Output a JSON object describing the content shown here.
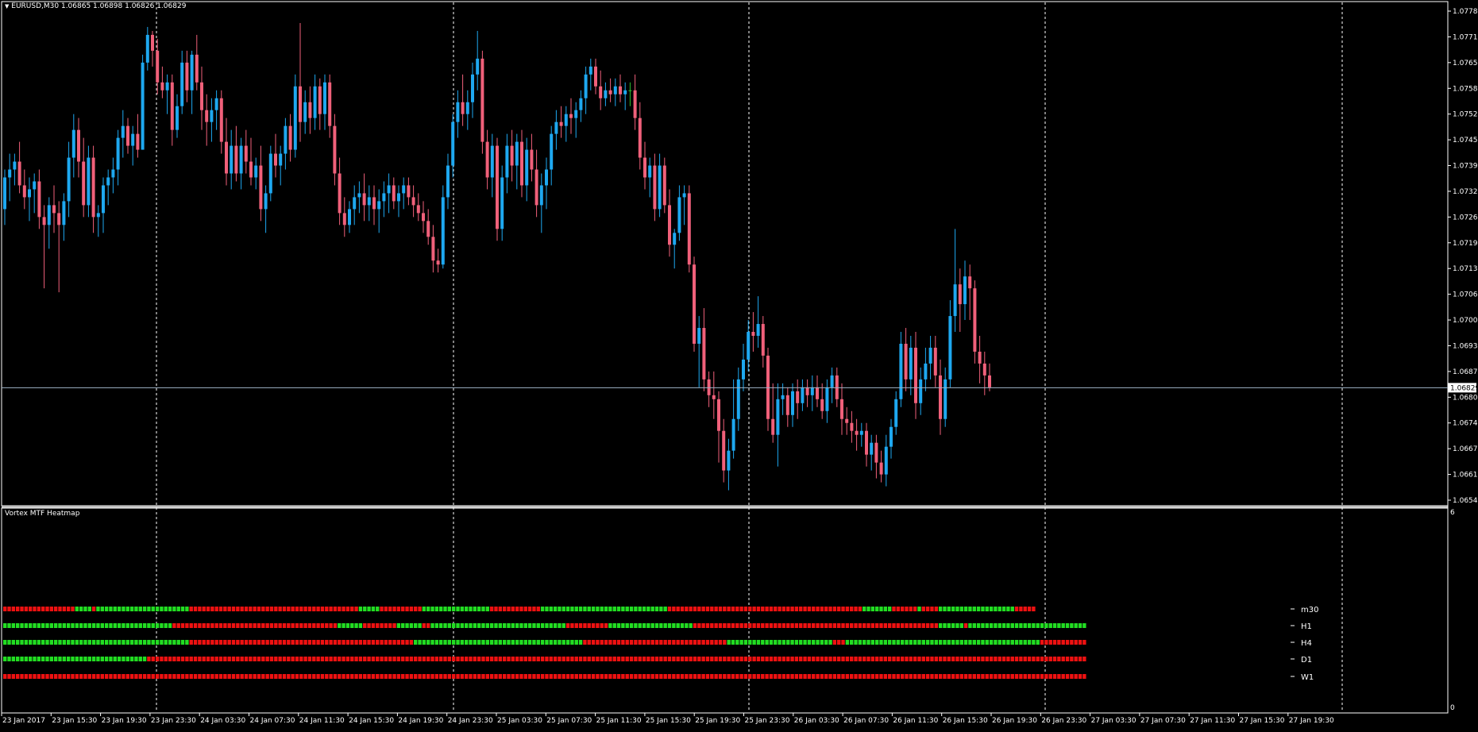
{
  "main_chart": {
    "symbol_line": "EURUSD,M30  1.06865 1.06898 1.06826 1.06829",
    "price_scale": {
      "labels": [
        "1.07780",
        "1.07715",
        "1.07650",
        "1.07585",
        "1.07520",
        "1.07455",
        "1.07390",
        "1.07325",
        "1.07260",
        "1.07195",
        "1.07130",
        "1.07065",
        "1.07000",
        "1.06935",
        "1.06870",
        "1.06805",
        "1.06740",
        "1.06675",
        "1.06610",
        "1.06545"
      ],
      "current_price": "1.06829"
    },
    "time_labels": [
      "23 Jan 2017",
      "23 Jan 15:30",
      "23 Jan 19:30",
      "23 Jan 23:30",
      "24 Jan 03:30",
      "24 Jan 07:30",
      "24 Jan 11:30",
      "24 Jan 15:30",
      "24 Jan 19:30",
      "24 Jan 23:30",
      "25 Jan 03:30",
      "25 Jan 07:30",
      "25 Jan 11:30",
      "25 Jan 15:30",
      "25 Jan 19:30",
      "25 Jan 23:30",
      "26 Jan 03:30",
      "26 Jan 07:30",
      "26 Jan 11:30",
      "26 Jan 15:30",
      "26 Jan 19:30",
      "26 Jan 23:30",
      "27 Jan 03:30",
      "27 Jan 07:30",
      "27 Jan 11:30",
      "27 Jan 15:30",
      "27 Jan 19:30"
    ],
    "colors": {
      "bull": "#1ea8f0",
      "bear": "#f0607a",
      "doji": "#2ec02e",
      "grid": "#ffffff",
      "price_line": "#9fb4c8"
    }
  },
  "indicator": {
    "title": "Vortex MTF Heatmap",
    "scale_top": "6",
    "scale_bottom": "0",
    "rows": [
      "m30",
      "H1",
      "H4",
      "D1",
      "W1"
    ],
    "colors": {
      "green": "#22dd22",
      "red": "#ee1111"
    }
  },
  "chart_data": {
    "type": "candlestick",
    "symbol": "EURUSD",
    "timeframe": "M30",
    "last_bar": {
      "open": 1.06865,
      "high": 1.06898,
      "low": 1.06826,
      "close": 1.06829
    },
    "ylim": [
      1.06545,
      1.0778
    ],
    "price_line": 1.06829,
    "grid": "vertical dashed separators",
    "ohlc": [
      [
        1.0728,
        1.0738,
        1.0724,
        1.0736
      ],
      [
        1.0736,
        1.0742,
        1.073,
        1.0738
      ],
      [
        1.0738,
        1.0742,
        1.0734,
        1.074
      ],
      [
        1.074,
        1.0745,
        1.0732,
        1.0734
      ],
      [
        1.0734,
        1.0738,
        1.0728,
        1.0731
      ],
      [
        1.0731,
        1.0736,
        1.0725,
        1.0733
      ],
      [
        1.0733,
        1.0737,
        1.0727,
        1.0735
      ],
      [
        1.0735,
        1.0738,
        1.0723,
        1.0726
      ],
      [
        1.0726,
        1.0729,
        1.0708,
        1.0724
      ],
      [
        1.0724,
        1.0731,
        1.0718,
        1.0729
      ],
      [
        1.0729,
        1.0734,
        1.0722,
        1.0727
      ],
      [
        1.0727,
        1.073,
        1.0707,
        1.0724
      ],
      [
        1.0724,
        1.0732,
        1.072,
        1.073
      ],
      [
        1.073,
        1.0745,
        1.0726,
        1.0741
      ],
      [
        1.0741,
        1.0752,
        1.0736,
        1.0748
      ],
      [
        1.0748,
        1.0751,
        1.0736,
        1.074
      ],
      [
        1.074,
        1.0746,
        1.0726,
        1.0729
      ],
      [
        1.0729,
        1.0744,
        1.0726,
        1.0741
      ],
      [
        1.0741,
        1.0744,
        1.0722,
        1.0726
      ],
      [
        1.0726,
        1.0729,
        1.0721,
        1.0727
      ],
      [
        1.0727,
        1.0736,
        1.0722,
        1.0734
      ],
      [
        1.0734,
        1.0738,
        1.0729,
        1.0736
      ],
      [
        1.0736,
        1.0741,
        1.0732,
        1.0738
      ],
      [
        1.0738,
        1.0748,
        1.0734,
        1.0746
      ],
      [
        1.0746,
        1.0753,
        1.0741,
        1.0749
      ],
      [
        1.0749,
        1.0751,
        1.0742,
        1.0744
      ],
      [
        1.0744,
        1.0749,
        1.0739,
        1.0747
      ],
      [
        1.0747,
        1.0752,
        1.0741,
        1.0743
      ],
      [
        1.0743,
        1.0767,
        1.0743,
        1.0765
      ],
      [
        1.0765,
        1.0774,
        1.0763,
        1.0772
      ],
      [
        1.0772,
        1.0773,
        1.0764,
        1.0768
      ],
      [
        1.0768,
        1.0771,
        1.0757,
        1.076
      ],
      [
        1.076,
        1.0764,
        1.0756,
        1.0758
      ],
      [
        1.0758,
        1.0762,
        1.0752,
        1.076
      ],
      [
        1.076,
        1.0762,
        1.0744,
        1.0748
      ],
      [
        1.0748,
        1.0757,
        1.0746,
        1.0754
      ],
      [
        1.0754,
        1.0768,
        1.0752,
        1.0765
      ],
      [
        1.0765,
        1.0768,
        1.0755,
        1.0758
      ],
      [
        1.0758,
        1.0768,
        1.0752,
        1.0767
      ],
      [
        1.0767,
        1.0772,
        1.0758,
        1.076
      ],
      [
        1.076,
        1.0764,
        1.0748,
        1.0753
      ],
      [
        1.0753,
        1.0757,
        1.0744,
        1.075
      ],
      [
        1.075,
        1.0756,
        1.0745,
        1.0753
      ],
      [
        1.0753,
        1.0758,
        1.0748,
        1.0756
      ],
      [
        1.0756,
        1.0758,
        1.0742,
        1.0745
      ],
      [
        1.0745,
        1.0751,
        1.0734,
        1.0737
      ],
      [
        1.0737,
        1.0748,
        1.0733,
        1.0744
      ],
      [
        1.0744,
        1.0749,
        1.0735,
        1.0737
      ],
      [
        1.0737,
        1.0746,
        1.0733,
        1.0744
      ],
      [
        1.0744,
        1.0748,
        1.0737,
        1.074
      ],
      [
        1.074,
        1.0746,
        1.0734,
        1.0736
      ],
      [
        1.0736,
        1.0741,
        1.0733,
        1.0739
      ],
      [
        1.0739,
        1.0744,
        1.0725,
        1.0728
      ],
      [
        1.0728,
        1.0734,
        1.0722,
        1.0732
      ],
      [
        1.0732,
        1.0744,
        1.073,
        1.0742
      ],
      [
        1.0742,
        1.0747,
        1.0736,
        1.0739
      ],
      [
        1.0739,
        1.0744,
        1.0734,
        1.0742
      ],
      [
        1.0742,
        1.0751,
        1.0738,
        1.0749
      ],
      [
        1.0749,
        1.0752,
        1.074,
        1.0743
      ],
      [
        1.0743,
        1.0762,
        1.0741,
        1.0759
      ],
      [
        1.0759,
        1.0775,
        1.0745,
        1.075
      ],
      [
        1.075,
        1.0758,
        1.0747,
        1.0755
      ],
      [
        1.0755,
        1.0759,
        1.0747,
        1.0751
      ],
      [
        1.0751,
        1.0762,
        1.0748,
        1.0759
      ],
      [
        1.0759,
        1.0761,
        1.0748,
        1.0752
      ],
      [
        1.0752,
        1.0762,
        1.0748,
        1.076
      ],
      [
        1.076,
        1.0762,
        1.0746,
        1.0749
      ],
      [
        1.0749,
        1.0752,
        1.0734,
        1.0737
      ],
      [
        1.0737,
        1.0741,
        1.0724,
        1.0727
      ],
      [
        1.0727,
        1.0731,
        1.0721,
        1.0724
      ],
      [
        1.0724,
        1.073,
        1.0722,
        1.0728
      ],
      [
        1.0728,
        1.0734,
        1.0724,
        1.0731
      ],
      [
        1.0731,
        1.0735,
        1.0727,
        1.0732
      ],
      [
        1.0732,
        1.0737,
        1.0725,
        1.0729
      ],
      [
        1.0729,
        1.0734,
        1.0725,
        1.0731
      ],
      [
        1.0731,
        1.0734,
        1.0724,
        1.0728
      ],
      [
        1.0728,
        1.0733,
        1.0722,
        1.073
      ],
      [
        1.073,
        1.0735,
        1.0726,
        1.0732
      ],
      [
        1.0732,
        1.0737,
        1.0727,
        1.0734
      ],
      [
        1.0734,
        1.0736,
        1.0728,
        1.073
      ],
      [
        1.073,
        1.0734,
        1.0726,
        1.0732
      ],
      [
        1.0732,
        1.0736,
        1.0728,
        1.0734
      ],
      [
        1.0734,
        1.0736,
        1.0729,
        1.0731
      ],
      [
        1.0731,
        1.0734,
        1.0726,
        1.0729
      ],
      [
        1.0729,
        1.0732,
        1.0725,
        1.0727
      ],
      [
        1.0727,
        1.073,
        1.0722,
        1.0725
      ],
      [
        1.0725,
        1.0728,
        1.0719,
        1.0721
      ],
      [
        1.0721,
        1.0724,
        1.0712,
        1.0715
      ],
      [
        1.0715,
        1.0718,
        1.0712,
        1.0714
      ],
      [
        1.0714,
        1.0734,
        1.0713,
        1.0731
      ],
      [
        1.0731,
        1.0742,
        1.0728,
        1.0739
      ],
      [
        1.0739,
        1.0752,
        1.0736,
        1.075
      ],
      [
        1.075,
        1.0758,
        1.0746,
        1.0755
      ],
      [
        1.0755,
        1.0762,
        1.0749,
        1.0752
      ],
      [
        1.0752,
        1.0758,
        1.0748,
        1.0755
      ],
      [
        1.0755,
        1.0765,
        1.0751,
        1.0762
      ],
      [
        1.0762,
        1.0773,
        1.0758,
        1.0766
      ],
      [
        1.0766,
        1.0768,
        1.0742,
        1.0745
      ],
      [
        1.0745,
        1.0748,
        1.0733,
        1.0736
      ],
      [
        1.0736,
        1.0747,
        1.0731,
        1.0744
      ],
      [
        1.0744,
        1.0746,
        1.072,
        1.0723
      ],
      [
        1.0723,
        1.0739,
        1.072,
        1.0736
      ],
      [
        1.0736,
        1.0747,
        1.0732,
        1.0744
      ],
      [
        1.0744,
        1.0748,
        1.0735,
        1.0739
      ],
      [
        1.0739,
        1.0747,
        1.0733,
        1.0745
      ],
      [
        1.0745,
        1.0748,
        1.0731,
        1.0734
      ],
      [
        1.0734,
        1.0746,
        1.073,
        1.0743
      ],
      [
        1.0743,
        1.0747,
        1.0735,
        1.0738
      ],
      [
        1.0738,
        1.0743,
        1.0726,
        1.0729
      ],
      [
        1.0729,
        1.0737,
        1.0722,
        1.0734
      ],
      [
        1.0734,
        1.0741,
        1.0728,
        1.0738
      ],
      [
        1.0738,
        1.0749,
        1.0734,
        1.0747
      ],
      [
        1.0747,
        1.0753,
        1.0743,
        1.075
      ],
      [
        1.075,
        1.0754,
        1.0746,
        1.0749
      ],
      [
        1.0749,
        1.0754,
        1.0745,
        1.0752
      ],
      [
        1.0752,
        1.0756,
        1.0747,
        1.0751
      ],
      [
        1.0751,
        1.0755,
        1.0746,
        1.0753
      ],
      [
        1.0753,
        1.0758,
        1.075,
        1.0756
      ],
      [
        1.0756,
        1.0764,
        1.0752,
        1.0762
      ],
      [
        1.0762,
        1.0766,
        1.0758,
        1.0764
      ],
      [
        1.0764,
        1.0766,
        1.0757,
        1.0759
      ],
      [
        1.0759,
        1.0763,
        1.0753,
        1.0756
      ],
      [
        1.0756,
        1.076,
        1.0754,
        1.0758
      ],
      [
        1.0758,
        1.0761,
        1.0755,
        1.0757
      ],
      [
        1.0757,
        1.0761,
        1.0754,
        1.0759
      ],
      [
        1.0759,
        1.0762,
        1.0755,
        1.0757
      ],
      [
        1.0757,
        1.076,
        1.0753,
        1.0758
      ],
      [
        1.0758,
        1.076,
        1.0754,
        1.0758
      ],
      [
        1.0758,
        1.0762,
        1.0748,
        1.0751
      ],
      [
        1.0751,
        1.0755,
        1.0738,
        1.0741
      ],
      [
        1.0741,
        1.0745,
        1.0733,
        1.0736
      ],
      [
        1.0736,
        1.0741,
        1.0731,
        1.0739
      ],
      [
        1.0739,
        1.0742,
        1.0725,
        1.0728
      ],
      [
        1.0728,
        1.0742,
        1.0726,
        1.0739
      ],
      [
        1.0739,
        1.0741,
        1.0727,
        1.0729
      ],
      [
        1.0729,
        1.0733,
        1.0716,
        1.0719
      ],
      [
        1.0719,
        1.0723,
        1.0713,
        1.0722
      ],
      [
        1.0722,
        1.0734,
        1.072,
        1.0731
      ],
      [
        1.0731,
        1.0734,
        1.0724,
        1.0732
      ],
      [
        1.0732,
        1.0734,
        1.0712,
        1.0714
      ],
      [
        1.0714,
        1.0716,
        1.0692,
        1.0694
      ],
      [
        1.0694,
        1.0701,
        1.0683,
        1.0698
      ],
      [
        1.0698,
        1.0703,
        1.0682,
        1.0685
      ],
      [
        1.0685,
        1.0687,
        1.0678,
        1.0681
      ],
      [
        1.0681,
        1.0687,
        1.0675,
        1.068
      ],
      [
        1.068,
        1.0682,
        1.0664,
        1.0672
      ],
      [
        1.0672,
        1.0675,
        1.0659,
        1.0662
      ],
      [
        1.0662,
        1.067,
        1.0657,
        1.0667
      ],
      [
        1.0667,
        1.0685,
        1.0665,
        1.0675
      ],
      [
        1.0675,
        1.0688,
        1.0672,
        1.0685
      ],
      [
        1.0685,
        1.0694,
        1.0682,
        1.069
      ],
      [
        1.069,
        1.07,
        1.0687,
        1.0697
      ],
      [
        1.0697,
        1.0702,
        1.0692,
        1.0696
      ],
      [
        1.0696,
        1.0706,
        1.0693,
        1.0699
      ],
      [
        1.0699,
        1.0701,
        1.0688,
        1.0691
      ],
      [
        1.0691,
        1.0693,
        1.0672,
        1.0675
      ],
      [
        1.0675,
        1.0684,
        1.0669,
        1.0671
      ],
      [
        1.0671,
        1.0684,
        1.0663,
        1.068
      ],
      [
        1.068,
        1.0684,
        1.0676,
        1.0681
      ],
      [
        1.0681,
        1.0683,
        1.0673,
        1.0676
      ],
      [
        1.0676,
        1.0684,
        1.0673,
        1.0682
      ],
      [
        1.0682,
        1.0685,
        1.0675,
        1.0679
      ],
      [
        1.0679,
        1.0685,
        1.0677,
        1.0683
      ],
      [
        1.0683,
        1.0685,
        1.0678,
        1.0681
      ],
      [
        1.0681,
        1.0686,
        1.0677,
        1.0683
      ],
      [
        1.0683,
        1.0686,
        1.0678,
        1.068
      ],
      [
        1.068,
        1.0684,
        1.0675,
        1.0677
      ],
      [
        1.0677,
        1.0685,
        1.0674,
        1.0683
      ],
      [
        1.0683,
        1.0688,
        1.0679,
        1.0686
      ],
      [
        1.0686,
        1.0688,
        1.0678,
        1.068
      ],
      [
        1.068,
        1.0684,
        1.0671,
        1.0675
      ],
      [
        1.0675,
        1.0678,
        1.0671,
        1.0674
      ],
      [
        1.0674,
        1.0677,
        1.0669,
        1.0672
      ],
      [
        1.0672,
        1.0675,
        1.0667,
        1.0671
      ],
      [
        1.0671,
        1.0674,
        1.0668,
        1.0672
      ],
      [
        1.0672,
        1.0674,
        1.0663,
        1.0666
      ],
      [
        1.0666,
        1.0671,
        1.0662,
        1.0669
      ],
      [
        1.0669,
        1.0671,
        1.066,
        1.0664
      ],
      [
        1.0664,
        1.0667,
        1.0659,
        1.0661
      ],
      [
        1.0661,
        1.0671,
        1.0658,
        1.0668
      ],
      [
        1.0668,
        1.0675,
        1.0665,
        1.0673
      ],
      [
        1.0673,
        1.0682,
        1.0671,
        1.068
      ],
      [
        1.068,
        1.0697,
        1.0678,
        1.0694
      ],
      [
        1.0694,
        1.0698,
        1.0682,
        1.0685
      ],
      [
        1.0685,
        1.0696,
        1.0681,
        1.0693
      ],
      [
        1.0693,
        1.0697,
        1.0675,
        1.0679
      ],
      [
        1.0679,
        1.0688,
        1.0676,
        1.0685
      ],
      [
        1.0685,
        1.0693,
        1.0682,
        1.0689
      ],
      [
        1.0689,
        1.0696,
        1.0685,
        1.0693
      ],
      [
        1.0693,
        1.0696,
        1.0683,
        1.0686
      ],
      [
        1.0686,
        1.069,
        1.0671,
        1.0675
      ],
      [
        1.0675,
        1.0688,
        1.0673,
        1.0685
      ],
      [
        1.0685,
        1.0705,
        1.0683,
        1.0701
      ],
      [
        1.0701,
        1.0723,
        1.0697,
        1.0709
      ],
      [
        1.0709,
        1.0713,
        1.0697,
        1.0704
      ],
      [
        1.0704,
        1.0715,
        1.07,
        1.0711
      ],
      [
        1.0711,
        1.0714,
        1.07,
        1.0708
      ],
      [
        1.0708,
        1.071,
        1.0689,
        1.0692
      ],
      [
        1.0692,
        1.0696,
        1.0684,
        1.0689
      ],
      [
        1.0689,
        1.0692,
        1.0681,
        1.0686
      ],
      [
        1.0686,
        1.0689,
        1.0682,
        1.0683
      ]
    ]
  }
}
